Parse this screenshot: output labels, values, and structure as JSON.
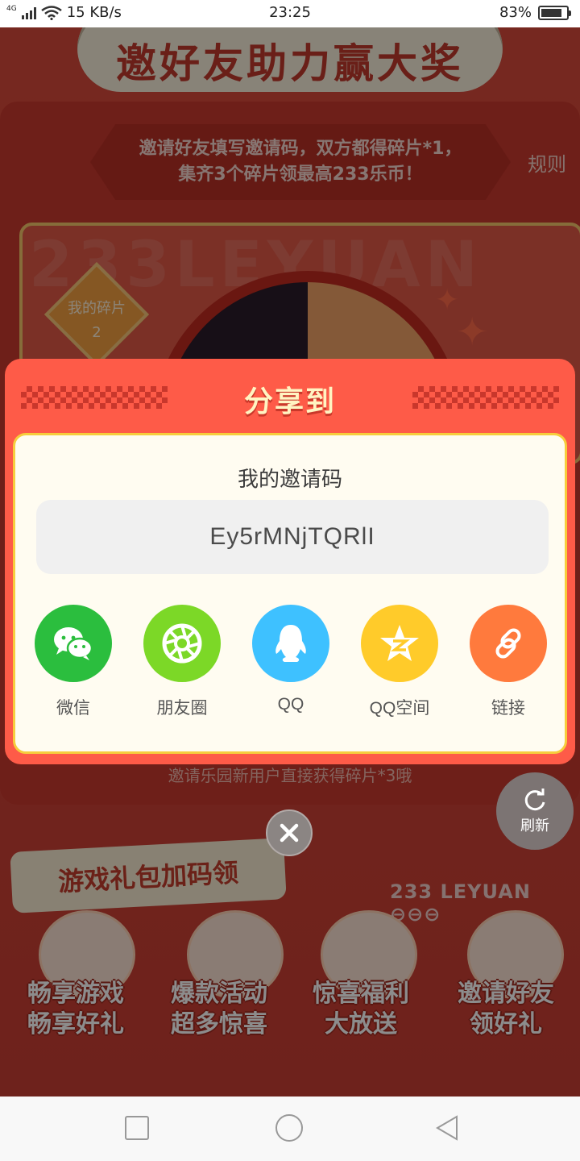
{
  "status_bar": {
    "network_type": "4G",
    "speed": "15 KB/s",
    "time": "23:25",
    "battery_percent": "83%",
    "battery_level": 0.83
  },
  "background": {
    "banner_title": "邀好友助力赢大奖",
    "invite_text_line1": "邀请好友填写邀请码，双方都得碎片*1，",
    "invite_text_line2": "集齐3个碎片领最高233乐币！",
    "rules_link": "规则",
    "watermark": "233LEYUAN",
    "fragments_label": "我的碎片",
    "fragments_count": "2",
    "bottom_hint": "邀请乐园新用户直接获得碎片*3哦",
    "gift_title": "游戏礼包加码领",
    "brand_right": "233 LEYUAN",
    "promos": [
      {
        "line1": "畅享游戏",
        "line2": "畅享好礼"
      },
      {
        "line1": "爆款活动",
        "line2": "超多惊喜"
      },
      {
        "line1": "惊喜福利",
        "line2": "大放送"
      },
      {
        "line1": "邀请好友",
        "line2": "领好礼"
      }
    ]
  },
  "refresh": {
    "label": "刷新",
    "icon": "refresh-icon"
  },
  "dialog": {
    "title": "分享到",
    "code_label": "我的邀请码",
    "invite_code": "Ey5rMNjTQRlI",
    "share_options": [
      {
        "label": "微信",
        "icon": "wechat-icon",
        "color": "#2bbe3e"
      },
      {
        "label": "朋友圈",
        "icon": "moments-icon",
        "color": "#7cd827"
      },
      {
        "label": "QQ",
        "icon": "qq-icon",
        "color": "#3ec1ff"
      },
      {
        "label": "QQ空间",
        "icon": "qzone-icon",
        "color": "#ffcb2a"
      },
      {
        "label": "链接",
        "icon": "link-icon",
        "color": "#ff7a3d"
      }
    ],
    "close_icon": "close-icon"
  },
  "colors": {
    "dialog_bg": "#fe5b48",
    "dialog_inner_bg": "#fffcf1",
    "dialog_border": "#f6cd3d",
    "title_color": "#fff4c2"
  },
  "nav_bar": {
    "icons": [
      "recent-apps-icon",
      "home-icon",
      "back-icon"
    ]
  }
}
